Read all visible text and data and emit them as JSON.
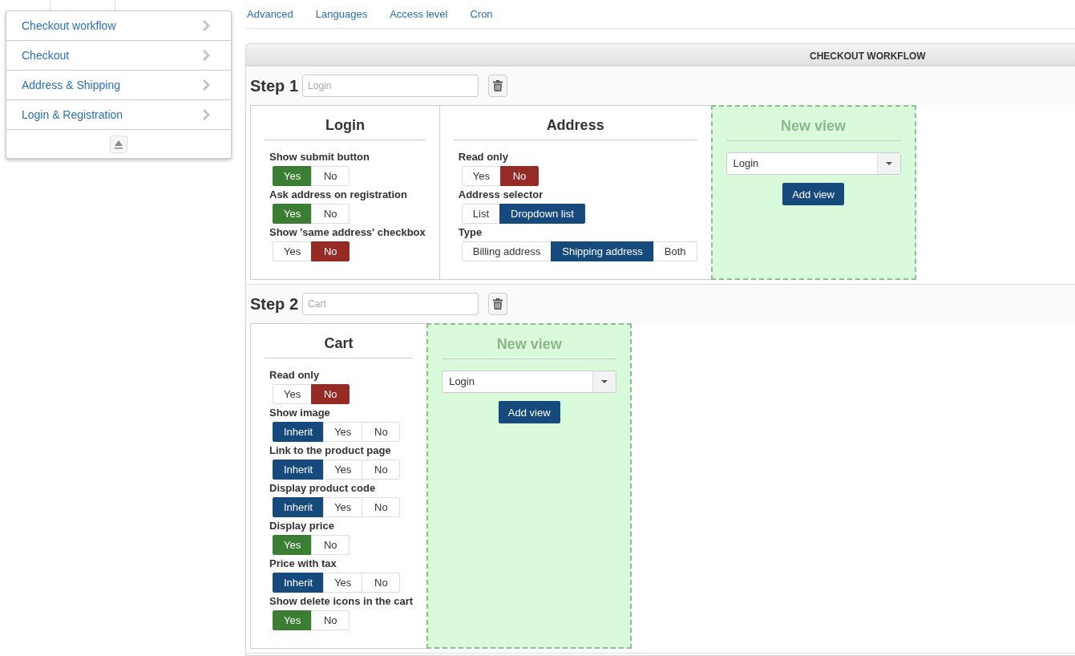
{
  "menu": {
    "items": [
      {
        "label": "Checkout workflow"
      },
      {
        "label": "Checkout"
      },
      {
        "label": "Address & Shipping"
      },
      {
        "label": "Login & Registration"
      }
    ]
  },
  "nav": {
    "links": [
      {
        "label": "Advanced"
      },
      {
        "label": "Languages"
      },
      {
        "label": "Access level"
      },
      {
        "label": "Cron"
      }
    ]
  },
  "panel": {
    "title": "CHECKOUT WORKFLOW",
    "steps": [
      {
        "label": "Step 1",
        "placeholder": "Login",
        "views": [
          {
            "kind": "view",
            "title": "Login",
            "options": [
              {
                "label": "Show submit button",
                "choices": [
                  {
                    "label": "Yes",
                    "kind": "yes",
                    "selected": true
                  },
                  {
                    "label": "No",
                    "kind": "no",
                    "selected": false
                  }
                ]
              },
              {
                "label": "Ask address on registration",
                "choices": [
                  {
                    "label": "Yes",
                    "kind": "yes",
                    "selected": true
                  },
                  {
                    "label": "No",
                    "kind": "no",
                    "selected": false
                  }
                ]
              },
              {
                "label": "Show 'same address' checkbox",
                "choices": [
                  {
                    "label": "Yes",
                    "kind": "yes",
                    "selected": false
                  },
                  {
                    "label": "No",
                    "kind": "no",
                    "selected": true
                  }
                ]
              }
            ]
          },
          {
            "kind": "view",
            "title": "Address",
            "options": [
              {
                "label": "Read only",
                "choices": [
                  {
                    "label": "Yes",
                    "kind": "yes",
                    "selected": false
                  },
                  {
                    "label": "No",
                    "kind": "no",
                    "selected": true
                  }
                ]
              },
              {
                "label": "Address selector",
                "choices": [
                  {
                    "label": "List",
                    "kind": "neutral",
                    "selected": false
                  },
                  {
                    "label": "Dropdown list",
                    "kind": "neutral",
                    "selected": true
                  }
                ]
              },
              {
                "label": "Type",
                "choices": [
                  {
                    "label": "Billing address",
                    "kind": "neutral",
                    "selected": false
                  },
                  {
                    "label": "Shipping address",
                    "kind": "neutral",
                    "selected": true
                  },
                  {
                    "label": "Both",
                    "kind": "neutral",
                    "selected": false
                  }
                ]
              }
            ]
          },
          {
            "kind": "new",
            "title": "New view",
            "select": "Login",
            "button": "Add view"
          }
        ]
      },
      {
        "label": "Step 2",
        "placeholder": "Cart",
        "views": [
          {
            "kind": "view",
            "title": "Cart",
            "options": [
              {
                "label": "Read only",
                "choices": [
                  {
                    "label": "Yes",
                    "kind": "yes",
                    "selected": false
                  },
                  {
                    "label": "No",
                    "kind": "no",
                    "selected": true
                  }
                ]
              },
              {
                "label": "Show image",
                "choices": [
                  {
                    "label": "Inherit",
                    "kind": "neutral",
                    "selected": true
                  },
                  {
                    "label": "Yes",
                    "kind": "yes",
                    "selected": false
                  },
                  {
                    "label": "No",
                    "kind": "no",
                    "selected": false
                  }
                ]
              },
              {
                "label": "Link to the product page",
                "choices": [
                  {
                    "label": "Inherit",
                    "kind": "neutral",
                    "selected": true
                  },
                  {
                    "label": "Yes",
                    "kind": "yes",
                    "selected": false
                  },
                  {
                    "label": "No",
                    "kind": "no",
                    "selected": false
                  }
                ]
              },
              {
                "label": "Display product code",
                "choices": [
                  {
                    "label": "Inherit",
                    "kind": "neutral",
                    "selected": true
                  },
                  {
                    "label": "Yes",
                    "kind": "yes",
                    "selected": false
                  },
                  {
                    "label": "No",
                    "kind": "no",
                    "selected": false
                  }
                ]
              },
              {
                "label": "Display price",
                "choices": [
                  {
                    "label": "Yes",
                    "kind": "yes",
                    "selected": true
                  },
                  {
                    "label": "No",
                    "kind": "no",
                    "selected": false
                  }
                ]
              },
              {
                "label": "Price with tax",
                "choices": [
                  {
                    "label": "Inherit",
                    "kind": "neutral",
                    "selected": true
                  },
                  {
                    "label": "Yes",
                    "kind": "yes",
                    "selected": false
                  },
                  {
                    "label": "No",
                    "kind": "no",
                    "selected": false
                  }
                ]
              },
              {
                "label": "Show delete icons in the cart",
                "choices": [
                  {
                    "label": "Yes",
                    "kind": "yes",
                    "selected": true
                  },
                  {
                    "label": "No",
                    "kind": "no",
                    "selected": false
                  }
                ]
              }
            ]
          },
          {
            "kind": "new",
            "title": "New view",
            "select": "Login",
            "button": "Add view"
          }
        ]
      }
    ]
  }
}
